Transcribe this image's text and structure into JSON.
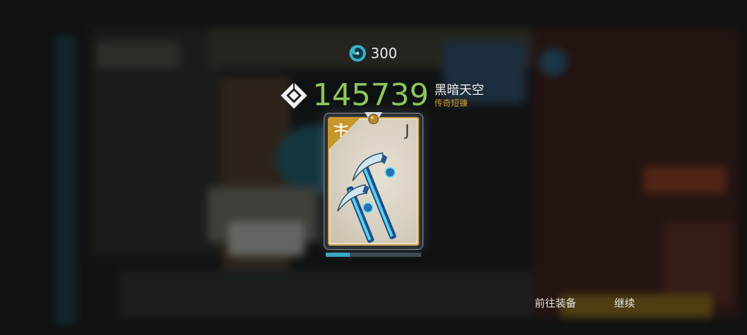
{
  "currency": {
    "icon": "swirl-orb-icon",
    "amount": "300"
  },
  "item": {
    "power": "145739",
    "power_icon": "diamond-power-icon",
    "name": "黑暗天空",
    "rarity_type": "传奇短镰",
    "rank": "J",
    "class_icon": "dragonfly-icon",
    "image": "twin-blue-scythes",
    "progress": 0.25
  },
  "actions": {
    "equip": "前往装备",
    "continue": "继续"
  },
  "colors": {
    "power": "#8ec65c",
    "rarity": "#d39b2b",
    "card_corner": "#c9962c",
    "progress": "#3aa7c0"
  }
}
